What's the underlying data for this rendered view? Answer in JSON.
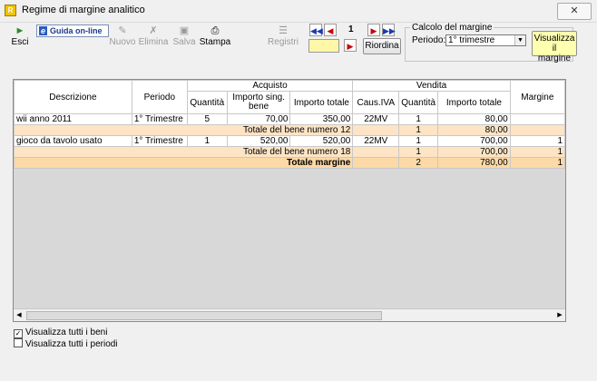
{
  "window": {
    "title": "Regime di margine analitico",
    "close_label": "✕"
  },
  "toolbar": {
    "esci": "Esci",
    "guida": "Guida on-line",
    "nuovo": "Nuovo",
    "elimina": "Elimina",
    "salva": "Salva",
    "stampa": "Stampa",
    "registri": "Registri",
    "page_number": "1",
    "riordina": "Riordina"
  },
  "calcolo": {
    "title": "Calcolo del margine",
    "periodo_label": "Periodo:",
    "periodo_value": "1° trimestre",
    "visualizza_line1": "Visualizza il",
    "visualizza_line2": "margine"
  },
  "grid": {
    "headers": {
      "descrizione": "Descrizione",
      "periodo": "Periodo",
      "acquisto": "Acquisto",
      "vendita": "Vendita",
      "quantita": "Quantità",
      "importo_sing_1": "Importo sing.",
      "importo_sing_2": "bene",
      "importo_totale": "Importo totale",
      "caus_iva": "Caus.IVA",
      "quantita_v": "Quantità",
      "importo_totale_v": "Importo totale",
      "margine": "Margine"
    },
    "rows": [
      {
        "descrizione": "wii anno 2011",
        "periodo": "1° Trimestre",
        "qta": "5",
        "imp_sing": "70,00",
        "imp_tot": "350,00",
        "caus": "22MV",
        "qta_v": "1",
        "imp_tot_v": "80,00",
        "margine": ""
      },
      {
        "label": "Totale del bene numero 12",
        "qta_v": "1",
        "imp_tot_v": "80,00",
        "margine": ""
      },
      {
        "descrizione": "gioco da tavolo usato",
        "periodo": "1° Trimestre",
        "qta": "1",
        "imp_sing": "520,00",
        "imp_tot": "520,00",
        "caus": "22MV",
        "qta_v": "1",
        "imp_tot_v": "700,00",
        "margine": "1"
      },
      {
        "label": "Totale del bene numero 18",
        "qta_v": "1",
        "imp_tot_v": "700,00",
        "margine": "1"
      },
      {
        "label": "Totale margine",
        "qta_v": "2",
        "imp_tot_v": "780,00",
        "margine": "1"
      }
    ]
  },
  "options": {
    "tutti_beni": "Visualizza tutti i beni",
    "tutti_periodi": "Visualizza tutti i periodi"
  }
}
